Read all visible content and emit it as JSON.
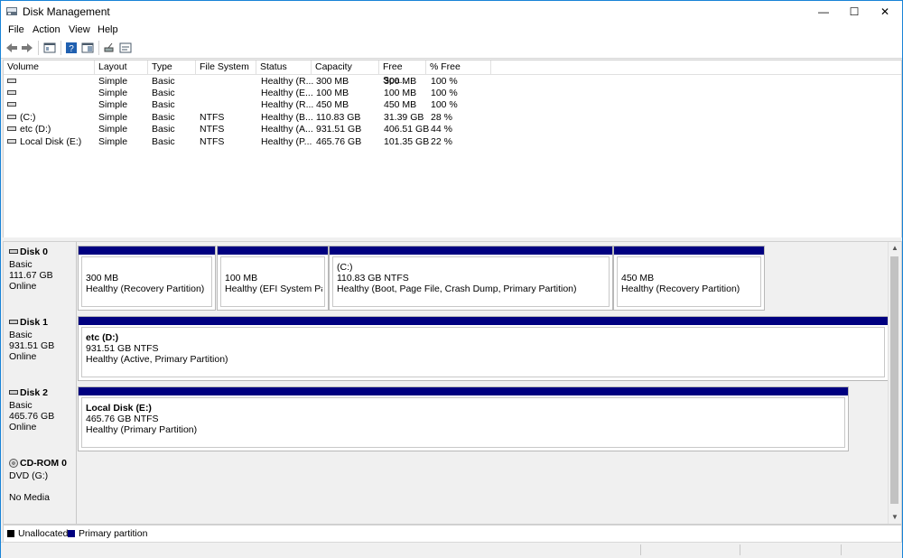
{
  "window": {
    "title": "Disk Management",
    "minimize": "—",
    "maximize": "☐",
    "close": "✕"
  },
  "menu": [
    "File",
    "Action",
    "View",
    "Help"
  ],
  "toolbar": [
    "back-icon",
    "forward-icon",
    "properties-icon",
    "help-icon",
    "show-hide-icon",
    "connect-icon",
    "console-icon"
  ],
  "columns": [
    "Volume",
    "Layout",
    "Type",
    "File System",
    "Status",
    "Capacity",
    "Free Spa...",
    "% Free"
  ],
  "volumes": [
    {
      "volume": "",
      "layout": "Simple",
      "type": "Basic",
      "fs": "",
      "status": "Healthy (R...",
      "capacity": "300 MB",
      "free": "300 MB",
      "pct": "100 %"
    },
    {
      "volume": "",
      "layout": "Simple",
      "type": "Basic",
      "fs": "",
      "status": "Healthy (E...",
      "capacity": "100 MB",
      "free": "100 MB",
      "pct": "100 %"
    },
    {
      "volume": "",
      "layout": "Simple",
      "type": "Basic",
      "fs": "",
      "status": "Healthy (R...",
      "capacity": "450 MB",
      "free": "450 MB",
      "pct": "100 %"
    },
    {
      "volume": "(C:)",
      "layout": "Simple",
      "type": "Basic",
      "fs": "NTFS",
      "status": "Healthy (B...",
      "capacity": "110.83 GB",
      "free": "31.39 GB",
      "pct": "28 %"
    },
    {
      "volume": "etc (D:)",
      "layout": "Simple",
      "type": "Basic",
      "fs": "NTFS",
      "status": "Healthy (A...",
      "capacity": "931.51 GB",
      "free": "406.51 GB",
      "pct": "44 %"
    },
    {
      "volume": "Local Disk (E:)",
      "layout": "Simple",
      "type": "Basic",
      "fs": "NTFS",
      "status": "Healthy (P...",
      "capacity": "465.76 GB",
      "free": "101.35 GB",
      "pct": "22 %"
    }
  ],
  "disks": [
    {
      "name": "Disk 0",
      "type": "Basic",
      "size": "111.67 GB",
      "state": "Online",
      "partitions": [
        {
          "title": "",
          "size": "300 MB",
          "status": "Healthy (Recovery Partition)"
        },
        {
          "title": "",
          "size": "100 MB",
          "status": "Healthy (EFI System Partitic"
        },
        {
          "title": "(C:)",
          "size": "110.83 GB NTFS",
          "status": "Healthy (Boot, Page File, Crash Dump, Primary Partition)"
        },
        {
          "title": "",
          "size": "450 MB",
          "status": "Healthy (Recovery Partition)"
        }
      ]
    },
    {
      "name": "Disk 1",
      "type": "Basic",
      "size": "931.51 GB",
      "state": "Online",
      "partitions": [
        {
          "title": "etc  (D:)",
          "size": "931.51 GB NTFS",
          "status": "Healthy (Active, Primary Partition)"
        }
      ]
    },
    {
      "name": "Disk 2",
      "type": "Basic",
      "size": "465.76 GB",
      "state": "Online",
      "partitions": [
        {
          "title": "Local Disk  (E:)",
          "size": "465.76 GB NTFS",
          "status": "Healthy (Primary Partition)"
        }
      ]
    },
    {
      "name": "CD-ROM 0",
      "type": "DVD (G:)",
      "size": "",
      "state": "No Media",
      "partitions": []
    }
  ],
  "legend": [
    {
      "label": "Unallocated",
      "color": "#000000"
    },
    {
      "label": "Primary partition",
      "color": "#000080"
    }
  ]
}
